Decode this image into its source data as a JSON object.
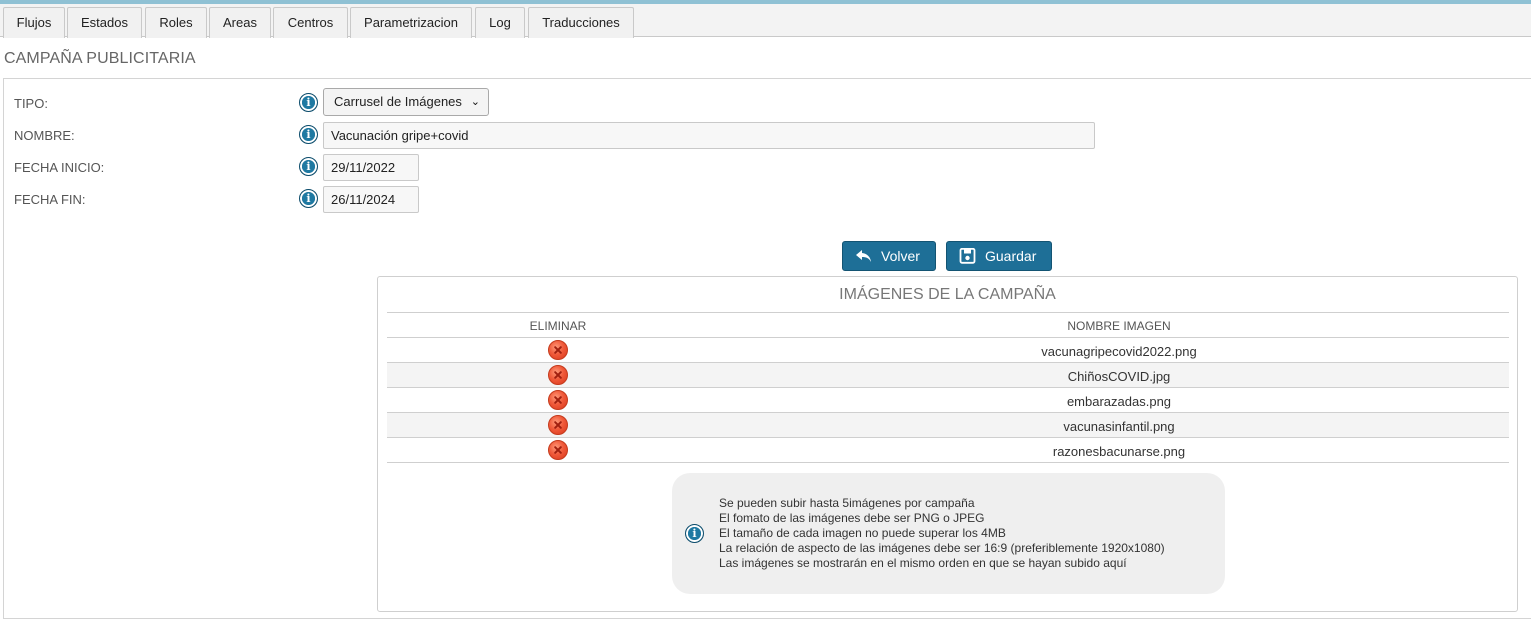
{
  "tabs": [
    {
      "label": "Flujos"
    },
    {
      "label": "Estados"
    },
    {
      "label": "Roles"
    },
    {
      "label": "Areas"
    },
    {
      "label": "Centros"
    },
    {
      "label": "Parametrizacion"
    },
    {
      "label": "Log"
    },
    {
      "label": "Traducciones"
    }
  ],
  "page": {
    "title": "CAMPAÑA PUBLICITARIA"
  },
  "form": {
    "tipo": {
      "label": "TIPO:",
      "value": "Carrusel de Imágenes"
    },
    "nombre": {
      "label": "NOMBRE:",
      "value": "Vacunación gripe+covid"
    },
    "fecha_inicio": {
      "label": "FECHA INICIO:",
      "value": "29/11/2022"
    },
    "fecha_fin": {
      "label": "FECHA FIN:",
      "value": "26/11/2024"
    }
  },
  "buttons": {
    "volver": "Volver",
    "guardar": "Guardar"
  },
  "gallery": {
    "title": "IMÁGENES DE LA CAMPAÑA",
    "columns": {
      "eliminar": "ELIMINAR",
      "nombre": "NOMBRE IMAGEN"
    },
    "rows": [
      {
        "name": "vacunagripecovid2022.png"
      },
      {
        "name": "ChiñosCOVID.jpg"
      },
      {
        "name": "embarazadas.png"
      },
      {
        "name": "vacunasinfantil.png"
      },
      {
        "name": "razonesbacunarse.png"
      }
    ]
  },
  "notice": {
    "lines": [
      "Se pueden subir hasta 5imágenes por campaña",
      "El fomato de las imágenes debe ser PNG o JPEG",
      "El tamaño de cada imagen no puede superar los 4MB",
      "La relación de aspecto de las imágenes debe ser 16:9 (preferiblemente 1920x1080)",
      "Las imágenes se mostrarán en el mismo orden en que se hayan subido aquí"
    ]
  },
  "colors": {
    "primary_button": "#1e6f97",
    "info_icon": "#1c6f95",
    "delete_icon": "#f05a3a",
    "top_accent": "#8fc1d4"
  }
}
